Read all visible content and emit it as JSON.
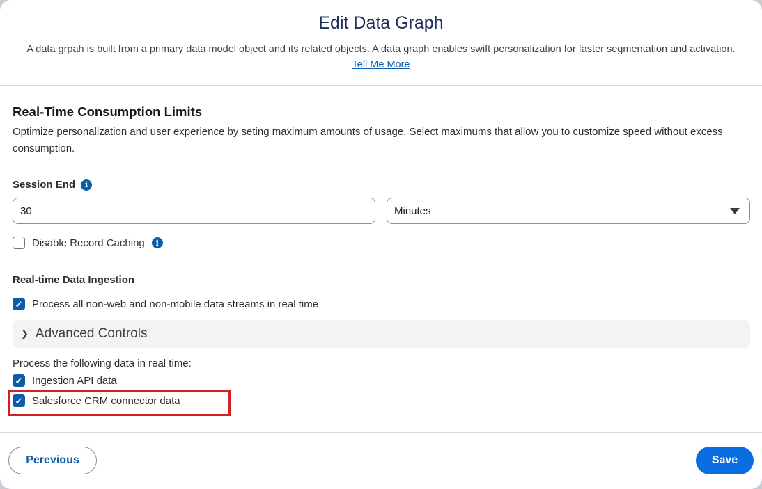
{
  "header": {
    "title": "Edit Data Graph",
    "description": "A data grpah is built from a primary data model object and its related objects. A data graph enables swift personalization for faster segmentation and activation.",
    "link_label": "Tell Me More"
  },
  "limits": {
    "title": "Real-Time Consumption Limits",
    "description": "Optimize personalization and user experience by seting maximum amounts of usage. Select maximums that allow you to customize speed without excess consumption."
  },
  "session_end": {
    "label": "Session End",
    "value": "30",
    "unit_selected": "Minutes",
    "info_icon": "info-icon"
  },
  "disable_caching": {
    "label": "Disable Record Caching",
    "checked": false
  },
  "ingestion": {
    "title": "Real-time Data Ingestion",
    "process_all": {
      "label": "Process all non-web and non-mobile data streams in real time",
      "checked": true
    }
  },
  "advanced": {
    "label": "Advanced Controls",
    "icon": "chevron-down-icon"
  },
  "realtime": {
    "label": "Process the following data in real time:",
    "items": [
      {
        "label": "Ingestion API data",
        "checked": true
      },
      {
        "label": "Salesforce CRM connector data",
        "checked": true
      }
    ]
  },
  "footer": {
    "prev_label": "Perevious",
    "save_label": "Save"
  },
  "colors": {
    "accent": "#0b5cab",
    "save_button": "#0b6ee0",
    "highlight": "#d62020"
  }
}
